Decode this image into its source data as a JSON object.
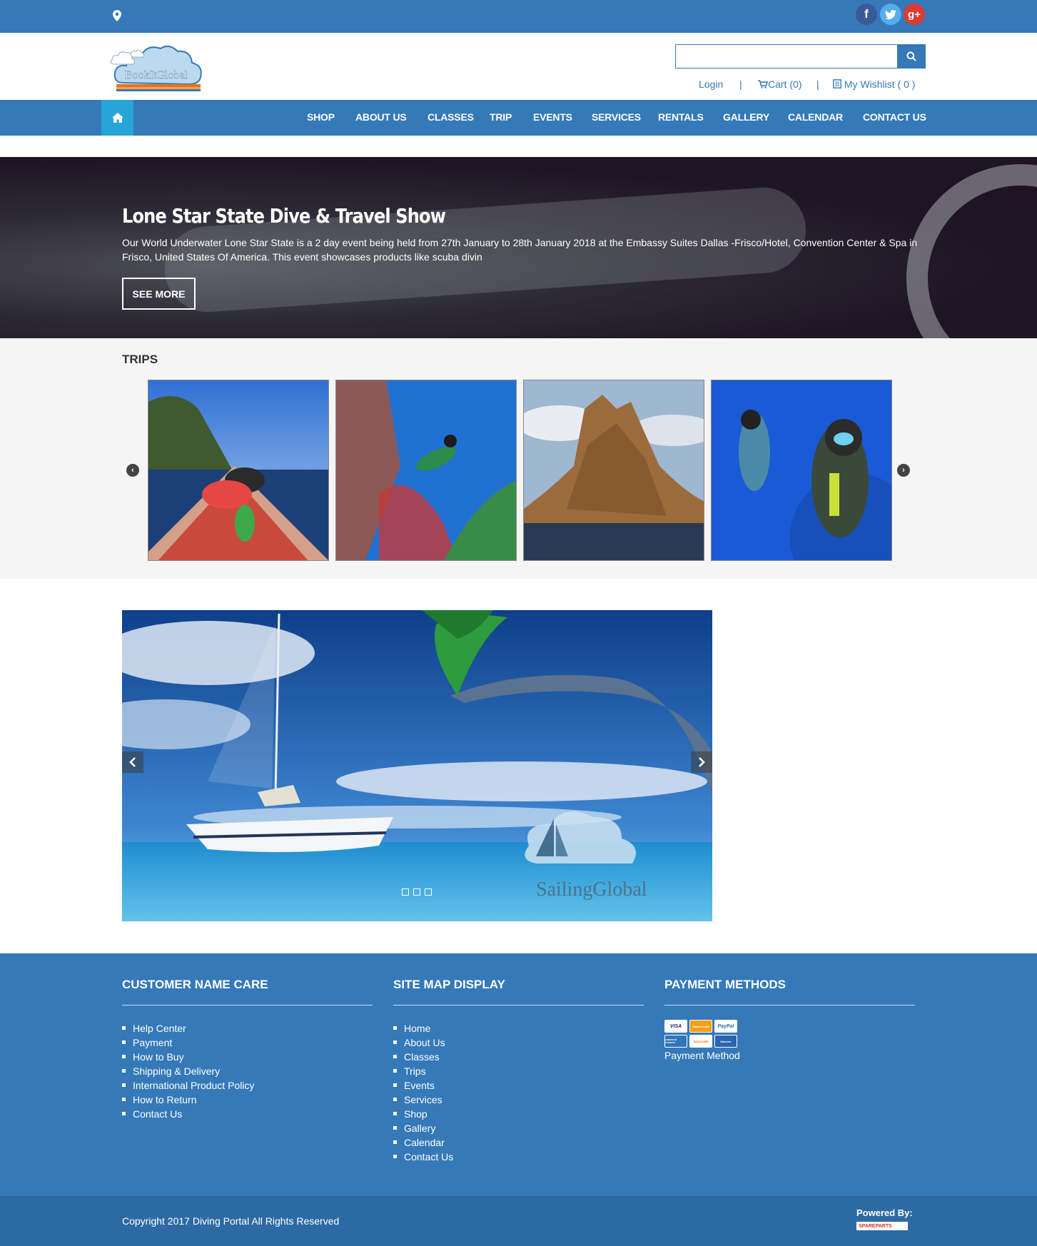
{
  "topbar": {
    "icons": [
      "map-marker-icon",
      "facebook-icon",
      "twitter-icon",
      "google-plus-icon"
    ]
  },
  "header": {
    "logo_text": "BookItGlobal",
    "search": {
      "placeholder": "",
      "value": ""
    },
    "login": "Login",
    "separator": "|",
    "cart": "Cart (0)",
    "wishlist": "My Wishlist ( 0 )"
  },
  "nav": {
    "items": [
      "SHOP",
      "ABOUT US",
      "CLASSES",
      "TRIP",
      "EVENTS",
      "SERVICES",
      "RENTALS",
      "GALLERY",
      "CALENDAR",
      "CONTACT US"
    ]
  },
  "hero": {
    "title": "Lone Star State Dive & Travel Show",
    "text": "Our World Underwater Lone Star State is a 2 day event being held from 27th January to 28th January 2018 at the Embassy Suites Dallas -Frisco/Hotel, Convention Center & Spa in Frisco, United States Of America. This event showcases products like scuba divin",
    "button": "SEE MORE"
  },
  "trips": {
    "title": "TRIPS"
  },
  "slider": {
    "watermark": "SailingGlobal"
  },
  "footer": {
    "col1": {
      "title": "CUSTOMER NAME CARE",
      "links": [
        "Help Center",
        "Payment",
        "How to Buy",
        "Shipping & Delivery",
        "International Product Policy",
        "How to Return",
        "Contact Us"
      ]
    },
    "col2": {
      "title": "SITE MAP DISPLAY",
      "links": [
        "Home",
        "About Us",
        "Classes",
        "Trips",
        "Events",
        "Services",
        "Shop",
        "Gallery",
        "Calendar",
        "Contact Us"
      ]
    },
    "col3": {
      "title": "PAYMENT METHODS",
      "cards": [
        "VISA",
        "MasterCard",
        "PayPal",
        "AMERICAN EXPRESS",
        "DISCOVER",
        "Maestro"
      ],
      "label": "Payment Method"
    },
    "copyright": "Copyright 2017 Diving Portal All Rights Reserved",
    "powered_by": "Powered By:",
    "powered_logo": "SPAREPARTS"
  },
  "colors": {
    "primary": "#3579b8",
    "home_button": "#27a5d8"
  }
}
